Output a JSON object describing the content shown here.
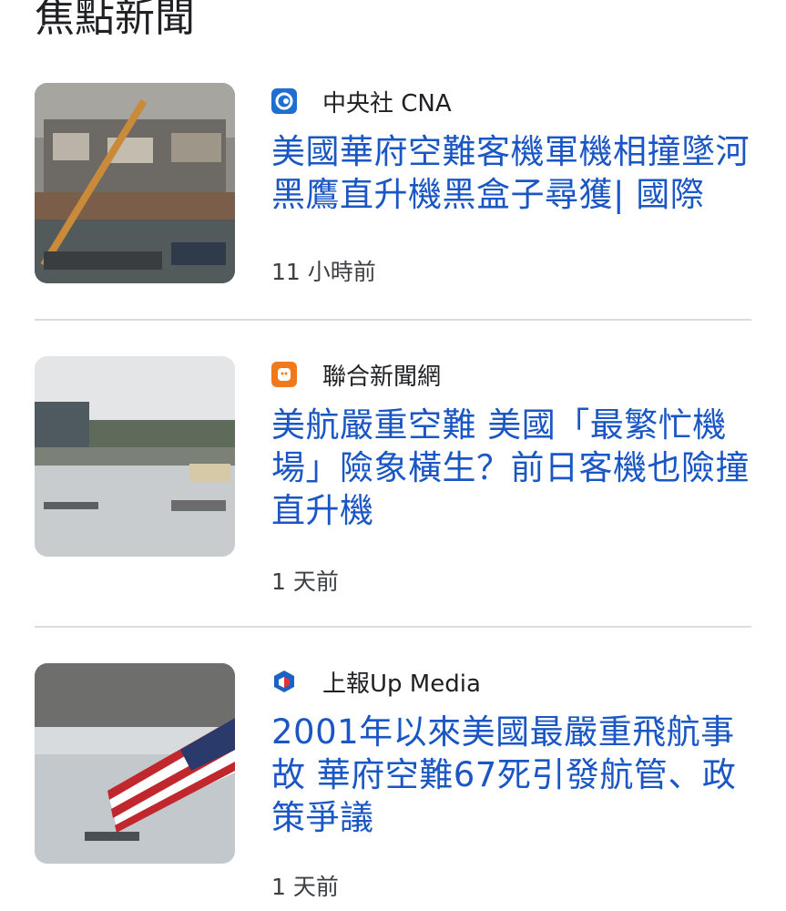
{
  "section_title": "焦點新聞",
  "articles": [
    {
      "source": "中央社 CNA",
      "source_icon": "cna-logo-icon",
      "headline": "美國華府空難客機軍機相撞墜河黑鷹直升機黑盒子尋獲| 國際",
      "time": "11 小時前",
      "brand_color": "#1f6fd1"
    },
    {
      "source": "聯合新聞網",
      "source_icon": "udn-logo-icon",
      "headline": "美航嚴重空難 美國「最繁忙機場」險象橫生？前日客機也險撞直升機",
      "time": "1 天前",
      "brand_color": "#f07a1a"
    },
    {
      "source": "上報Up Media",
      "source_icon": "upmedia-logo-icon",
      "headline": "2001年以來美國最嚴重飛航事故 華府空難67死引發航管、政策爭議",
      "time": "1 天前",
      "brand_color": "#1a63c4"
    }
  ]
}
